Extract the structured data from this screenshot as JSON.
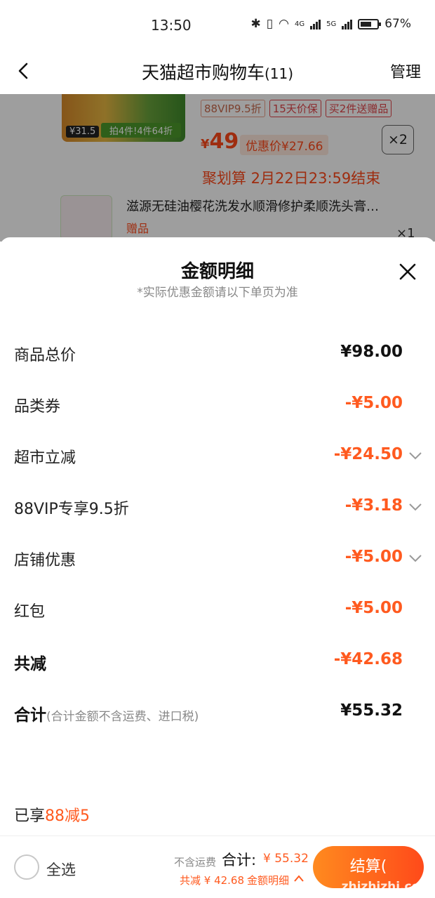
{
  "status": {
    "time": "13:50",
    "net1": "4G",
    "net2": "5G",
    "battery": "67%",
    "battery_level": 0.67
  },
  "header": {
    "title": "天猫超市购物车",
    "count": "(11)",
    "manage": "管理"
  },
  "cart_item": {
    "thumb_price": "¥31.5",
    "thumb_promo": "拍4件!4件64折",
    "tags": [
      "88VIP9.5折",
      "15天价保",
      "买2件送赠品"
    ],
    "price": "49",
    "discount": "优惠价¥27.66",
    "quantity": "×2",
    "juhuasuan": "聚划算 2月22日23:59结束",
    "gift_name": "滋源无硅油樱花洗发水顺滑修护柔顺洗头膏…",
    "gift_tag": "赠品",
    "gift_qty": "×1"
  },
  "sheet": {
    "title": "金额明细",
    "subtitle": "*实际优惠金额请以下单页为准",
    "rows": [
      {
        "label": "商品总价",
        "value": "¥98.00"
      },
      {
        "label": "品类券",
        "value": "-¥5.00"
      },
      {
        "label": "超市立减",
        "value": "-¥24.50"
      },
      {
        "label": "88VIP专享9.5折",
        "value": "-¥3.18"
      },
      {
        "label": "店铺优惠",
        "value": "-¥5.00"
      },
      {
        "label": "红包",
        "value": "-¥5.00"
      },
      {
        "label": "共减",
        "value": "-¥42.68"
      },
      {
        "label": "合计",
        "note": "(合计金额不含运费、进口税)",
        "value": "¥55.32"
      }
    ],
    "enjoyed_prefix": "已享",
    "enjoyed_highlight": "88减5"
  },
  "bottom": {
    "select_all": "全选",
    "no_shipping": "不含运费",
    "total_label": "合计:",
    "total_value": "¥ 55.32",
    "saved": "共减 ¥ 42.68",
    "detail": "金额明细",
    "checkout": "结算(",
    "watermark": "zhizhizhi.com"
  },
  "colors": {
    "accent": "#ff5a1f",
    "text": "#111111",
    "muted": "#888888"
  }
}
